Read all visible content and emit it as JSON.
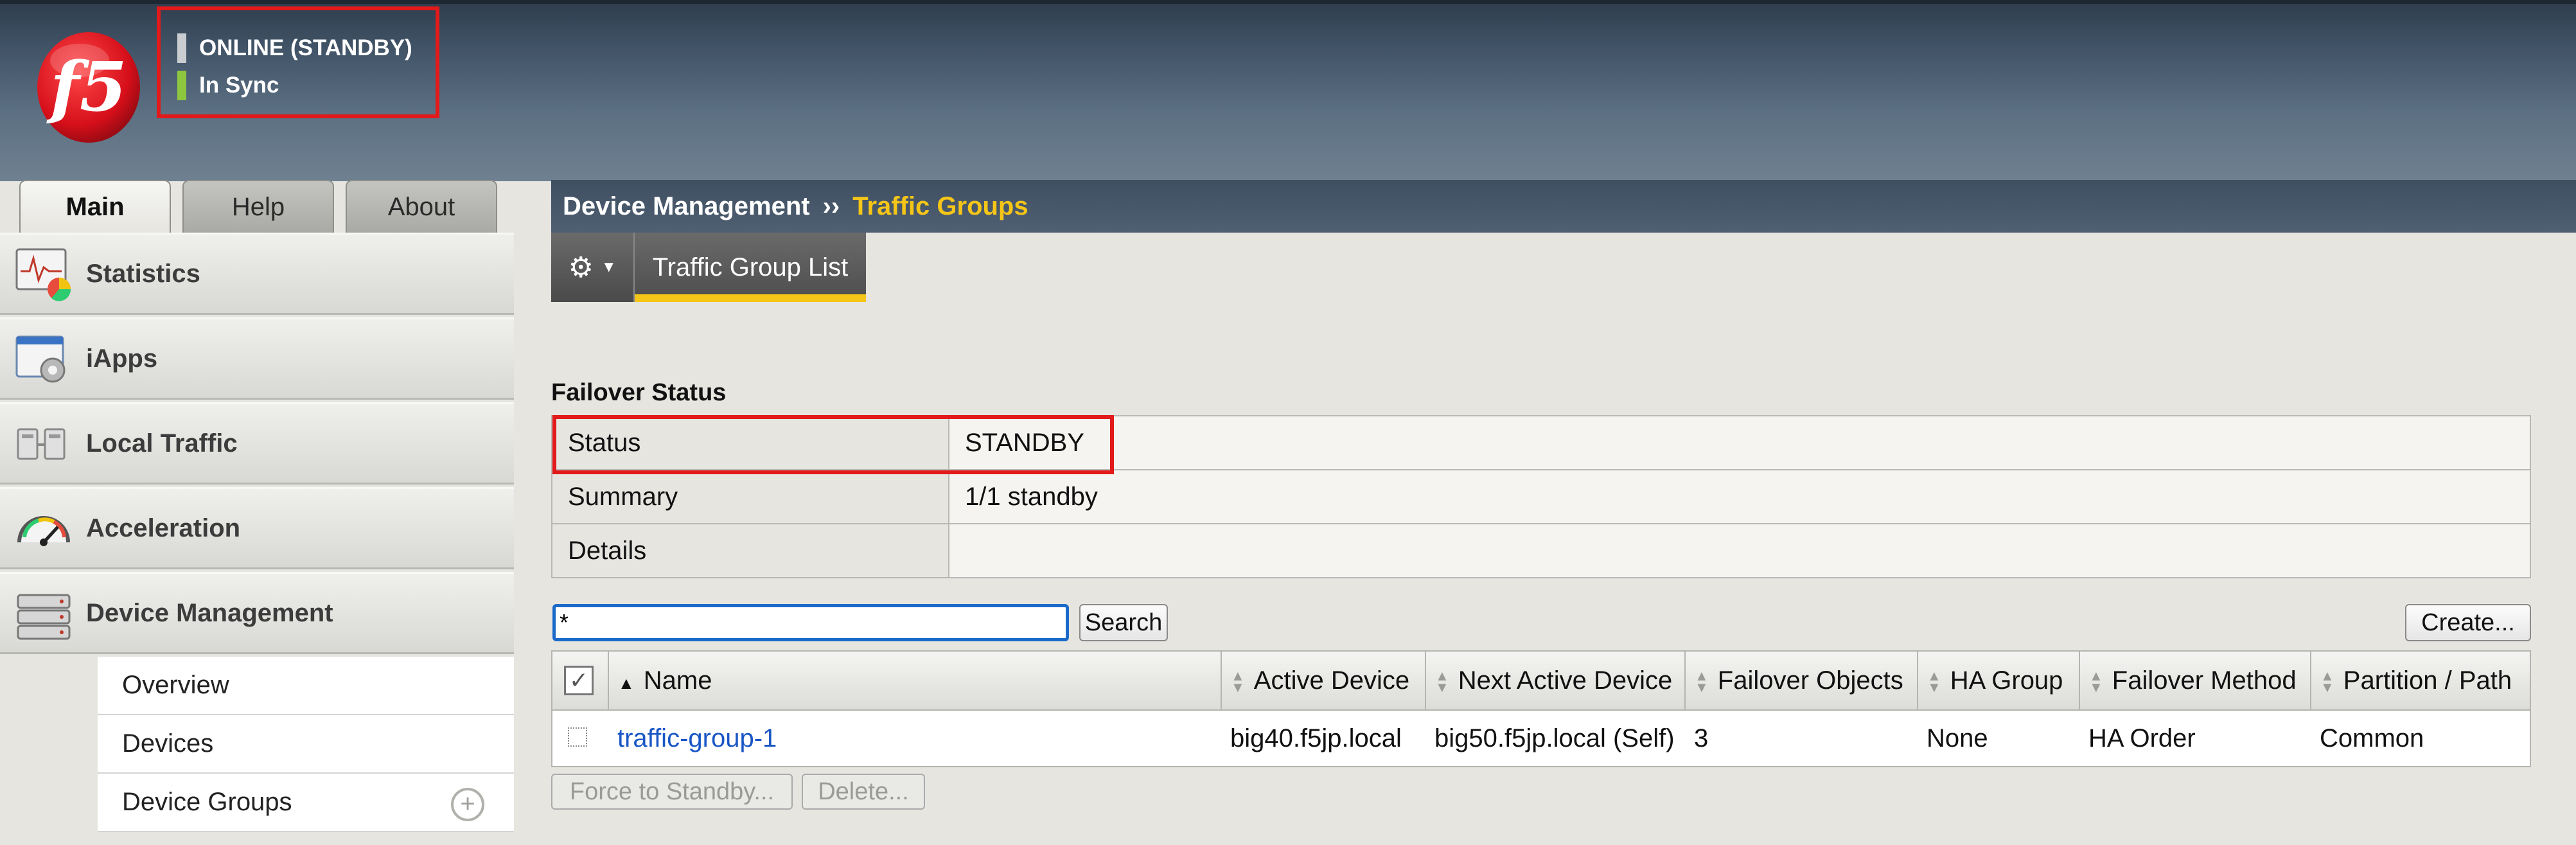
{
  "banner": {
    "status_primary": "ONLINE (STANDBY)",
    "status_secondary": "In Sync",
    "logo_text": "f5"
  },
  "left_tabs": [
    {
      "label": "Main",
      "active": true
    },
    {
      "label": "Help",
      "active": false
    },
    {
      "label": "About",
      "active": false
    }
  ],
  "sidebar": {
    "items": [
      {
        "label": "Statistics",
        "icon": "statistics-icon"
      },
      {
        "label": "iApps",
        "icon": "iapps-icon"
      },
      {
        "label": "Local Traffic",
        "icon": "local-traffic-icon"
      },
      {
        "label": "Acceleration",
        "icon": "acceleration-icon"
      },
      {
        "label": "Device Management",
        "icon": "device-management-icon"
      }
    ],
    "submenu": [
      {
        "label": "Overview"
      },
      {
        "label": "Devices"
      },
      {
        "label": "Device Groups",
        "has_add": true
      }
    ],
    "add_symbol": "+"
  },
  "header": {
    "breadcrumb": "Device Management",
    "separator": "››",
    "current": "Traffic Groups"
  },
  "toolbar": {
    "tab_label": "Traffic Group List"
  },
  "failover": {
    "title": "Failover Status",
    "rows": [
      {
        "label": "Status",
        "value": "STANDBY"
      },
      {
        "label": "Summary",
        "value": "1/1 standby"
      },
      {
        "label": "Details",
        "value": ""
      }
    ]
  },
  "search": {
    "value": "*",
    "button_label": "Search"
  },
  "create_label": "Create...",
  "table": {
    "columns": [
      "Name",
      "Active Device",
      "Next Active Device",
      "Failover Objects",
      "HA Group",
      "Failover Method",
      "Partition / Path"
    ],
    "rows": [
      {
        "name": "traffic-group-1",
        "active_device": "big40.f5jp.local",
        "next_active_device": "big50.f5jp.local (Self)",
        "failover_objects": "3",
        "ha_group": "None",
        "failover_method": "HA Order",
        "partition": "Common"
      }
    ]
  },
  "actions": {
    "force_standby": "Force to Standby...",
    "delete": "Delete..."
  },
  "colors": {
    "highlight_red": "#e21a1a",
    "breadcrumb_active": "#f5c518",
    "sync_green": "#8dc63f",
    "link_blue": "#1a56c5"
  }
}
